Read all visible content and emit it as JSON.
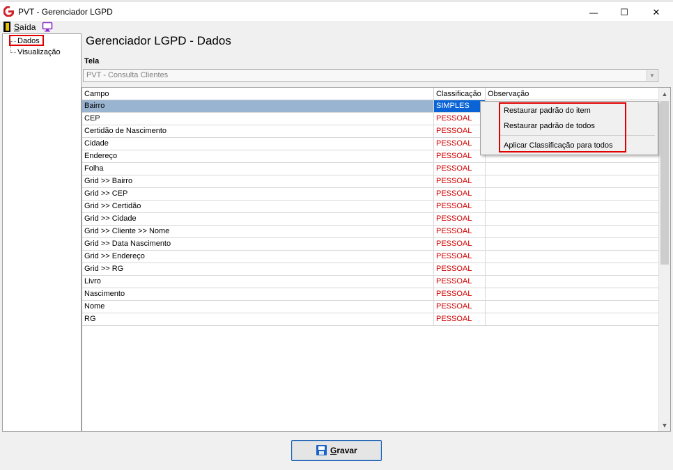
{
  "window": {
    "title": "PVT - Gerenciador LGPD",
    "minimize": "—",
    "maximize": "☐",
    "close": "✕"
  },
  "menu": {
    "saida_label": "Saída",
    "saida_first_letter": "S",
    "saida_rest": "aída"
  },
  "tree": {
    "items": [
      {
        "label": "Dados"
      },
      {
        "label": "Visualização"
      }
    ]
  },
  "header": {
    "title": "Gerenciador LGPD - Dados"
  },
  "tela": {
    "label": "Tela",
    "selected": "PVT - Consulta Clientes"
  },
  "grid": {
    "columns": [
      "Campo",
      "Classificação",
      "Observação"
    ],
    "rows": [
      {
        "campo": "Bairro",
        "classificacao": "SIMPLES",
        "observacao": ""
      },
      {
        "campo": "CEP",
        "classificacao": "PESSOAL",
        "observacao": ""
      },
      {
        "campo": "Certidão de Nascimento",
        "classificacao": "PESSOAL",
        "observacao": ""
      },
      {
        "campo": "Cidade",
        "classificacao": "PESSOAL",
        "observacao": ""
      },
      {
        "campo": "Endereço",
        "classificacao": "PESSOAL",
        "observacao": ""
      },
      {
        "campo": "Folha",
        "classificacao": "PESSOAL",
        "observacao": ""
      },
      {
        "campo": "Grid >> Bairro",
        "classificacao": "PESSOAL",
        "observacao": ""
      },
      {
        "campo": "Grid >> CEP",
        "classificacao": "PESSOAL",
        "observacao": ""
      },
      {
        "campo": "Grid >> Certidão",
        "classificacao": "PESSOAL",
        "observacao": ""
      },
      {
        "campo": "Grid >> Cidade",
        "classificacao": "PESSOAL",
        "observacao": ""
      },
      {
        "campo": "Grid >> Cliente >> Nome",
        "classificacao": "PESSOAL",
        "observacao": ""
      },
      {
        "campo": "Grid >> Data Nascimento",
        "classificacao": "PESSOAL",
        "observacao": ""
      },
      {
        "campo": "Grid >> Endereço",
        "classificacao": "PESSOAL",
        "observacao": ""
      },
      {
        "campo": "Grid >> RG",
        "classificacao": "PESSOAL",
        "observacao": ""
      },
      {
        "campo": "Livro",
        "classificacao": "PESSOAL",
        "observacao": ""
      },
      {
        "campo": "Nascimento",
        "classificacao": "PESSOAL",
        "observacao": ""
      },
      {
        "campo": "Nome",
        "classificacao": "PESSOAL",
        "observacao": ""
      },
      {
        "campo": "RG",
        "classificacao": "PESSOAL",
        "observacao": ""
      }
    ]
  },
  "context_menu": {
    "items": [
      "Restaurar padrão do item",
      "Restaurar padrão de todos",
      "Aplicar Classificação para todos"
    ]
  },
  "footer": {
    "save_first_letter": "G",
    "save_rest": "ravar"
  },
  "colors": {
    "classification_text": "#d00000",
    "selection_bg": "#0a64d6",
    "highlight_box": "#e00000",
    "brand_icon": "#d0202a"
  }
}
